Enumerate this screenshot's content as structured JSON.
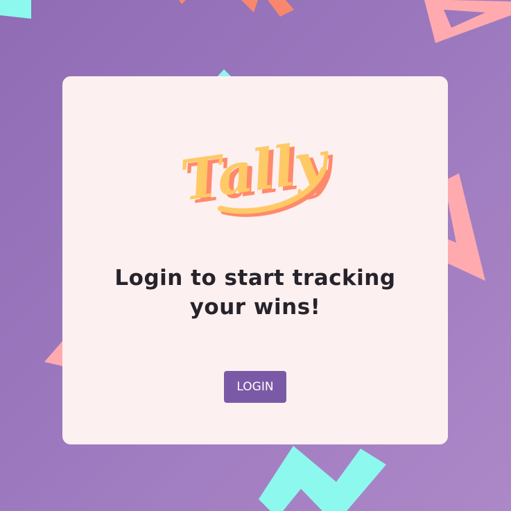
{
  "logo": {
    "text": "Tally"
  },
  "headline": "Login to start tracking your wins!",
  "login_button": {
    "label": "LOGIN"
  },
  "colors": {
    "background_start": "#8f6cb4",
    "background_end": "#ad88c8",
    "card": "#fdf0f1",
    "logo_fill": "#ffc966",
    "logo_shadow": "#ff8a6b",
    "button": "#7a5aa6",
    "shape_cyan": "#8df8ee",
    "shape_pink": "#ffaaaf",
    "shape_orange": "#f8876d"
  }
}
